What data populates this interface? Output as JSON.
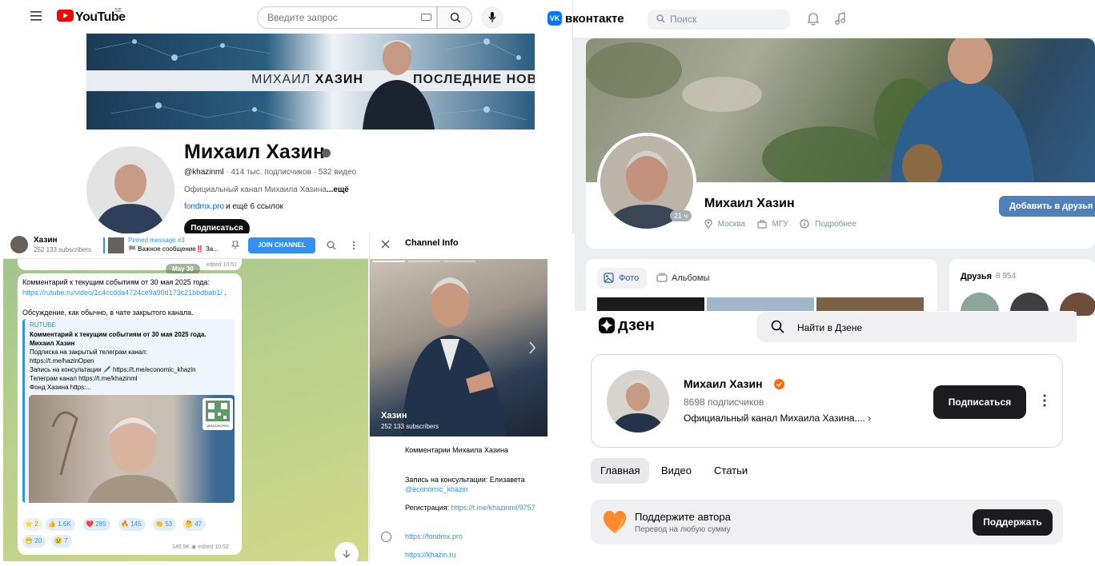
{
  "youtube": {
    "logo_text": "YouTube",
    "country_code": "SE",
    "search_placeholder": "Введите запрос",
    "banner_name_first": "МИХАИЛ ",
    "banner_name_last": "ХАЗИН",
    "banner_news": "ПОСЛЕДНИЕ НОВО",
    "channel_name": "Михаил Хазин",
    "handle": "@khazinml",
    "stats": " · 414 тыс. подписчиков · 532 видео",
    "description": "Официальный канал Михаила Хазина",
    "description_more": "...ещё",
    "link": "fondmx.pro",
    "link_more": "и ещё 6 ссылок",
    "subscribe_label": "Подписаться"
  },
  "vk": {
    "logo_text": "вконтакте",
    "search_placeholder": "Поиск",
    "name": "Михаил Хазин",
    "online_ago": "21 ч",
    "city": "Москва",
    "university": "МГУ",
    "details": "Подробнее",
    "add_friend_label": "Добавить в друзья",
    "photos_tab": "Фото",
    "albums_tab": "Альбомы",
    "friends_title": "Друзья",
    "friends_count": "8 954"
  },
  "telegram": {
    "channel_name": "Хазин",
    "subscribers": "252 133 subscribers",
    "pinned_title": "Pinned message #3",
    "pinned_text": "🏁 Важное сообщение‼️ За...",
    "join_label": "JOIN CHANNEL",
    "date_badge": "May 30",
    "edited_top": "edited 10:51",
    "message_text": "Комментарий к текущим событиям от 30 мая 2025 года: ",
    "message_link": "https://rutube.ru/video/1c4ccdda4724ce9a90d173c21bbdbab1/",
    "message_end": " .",
    "message_text2": "Обсуждение, как обычно, в чате закрытого канала.",
    "preview": {
      "site": "RUTUBE",
      "title": "Комментарий к текущим событиям от 30 мая 2025 года. Михаил Хазин",
      "body_lines": [
        "Подписка на закрытый телеграм канал:",
        "https://t.me/hazinOpen",
        "Запись на консультации 🖊️ https://t.me/economic_khazin",
        "Телеграм канал https://t.me/khazinml",
        "Фонд Хазина https:..."
      ],
      "qr_caption": "@HAZINOPEN"
    },
    "reactions": [
      {
        "emoji": "⭐",
        "count": "2"
      },
      {
        "emoji": "👍",
        "count": "1.6K"
      },
      {
        "emoji": "❤️",
        "count": "285"
      },
      {
        "emoji": "🔥",
        "count": "145"
      },
      {
        "emoji": "👏",
        "count": "53"
      },
      {
        "emoji": "🤔",
        "count": "47"
      },
      {
        "emoji": "😁",
        "count": "20"
      },
      {
        "emoji": "😢",
        "count": "7"
      }
    ],
    "views": "146.9K",
    "edited_bottom": "edited 10:52",
    "info": {
      "title": "Channel Info",
      "name": "Хазин",
      "subscribers": "252 133 subscribers",
      "bio": "Комментарии Михаила Хазина",
      "consult_text": "Запись на консультации: Елизавета ",
      "consult_link": "@economic_khazin",
      "reg_text": "Регистрация: ",
      "reg_link": "https://t.me/khazinml/9757",
      "link1": "https://fondmx.pro",
      "link2": "https://khazin.ru"
    }
  },
  "dzen": {
    "logo_text": "дзен",
    "search_placeholder": "Найти в Дзене",
    "name": "Михаил Хазин",
    "subscribers": "8698 подписчиков",
    "description": "Официальный канал Михаила Хазина....",
    "subscribe_label": "Подписаться",
    "tabs": [
      "Главная",
      "Видео",
      "Статьи"
    ],
    "support_title": "Поддержите автора",
    "support_sub": "Перевод на любую сумму",
    "support_button": "Поддержать"
  }
}
